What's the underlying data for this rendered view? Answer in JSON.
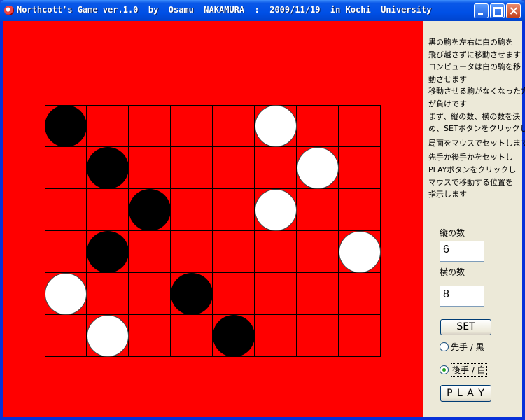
{
  "window": {
    "title": "Northcott's Game ver.1.0  by  Osamu  NAKAMURA  :  2009/11/19  in Kochi  University",
    "buttons": [
      "minimize-icon",
      "maximize-icon",
      "close-icon"
    ]
  },
  "board": {
    "rows": 6,
    "cols": 8,
    "background": "#ff0000",
    "pieces": [
      {
        "row": 0,
        "col": 0,
        "color": "black"
      },
      {
        "row": 0,
        "col": 5,
        "color": "white"
      },
      {
        "row": 1,
        "col": 1,
        "color": "black"
      },
      {
        "row": 1,
        "col": 6,
        "color": "white"
      },
      {
        "row": 2,
        "col": 2,
        "color": "black"
      },
      {
        "row": 2,
        "col": 5,
        "color": "white"
      },
      {
        "row": 3,
        "col": 1,
        "color": "black"
      },
      {
        "row": 3,
        "col": 7,
        "color": "white"
      },
      {
        "row": 4,
        "col": 0,
        "color": "white"
      },
      {
        "row": 4,
        "col": 3,
        "color": "black"
      },
      {
        "row": 5,
        "col": 1,
        "color": "white"
      },
      {
        "row": 5,
        "col": 4,
        "color": "black"
      }
    ]
  },
  "panel": {
    "instructions": [
      "黒の駒を左右に白の駒を",
      "飛び越さずに移動させます",
      "コンピュータは白の駒を移",
      "動させます",
      "移動させる駒がなくなった方",
      "が負けです",
      "まず、縦の数、横の数を決",
      "め、SETボタンをクリックし",
      "局面をマウスでセットします",
      "先手か後手かをセットし",
      "PLAYボタンをクリックし",
      "マウスで移動する位置を",
      "指示します"
    ],
    "rows_label": "縦の数",
    "rows_value": "6",
    "cols_label": "横の数",
    "cols_value": "8",
    "set_button": "SET",
    "radio_first": "先手 / 黒",
    "radio_second": "後手 / 白",
    "selected_radio": "second",
    "play_button": "P L A Y"
  }
}
